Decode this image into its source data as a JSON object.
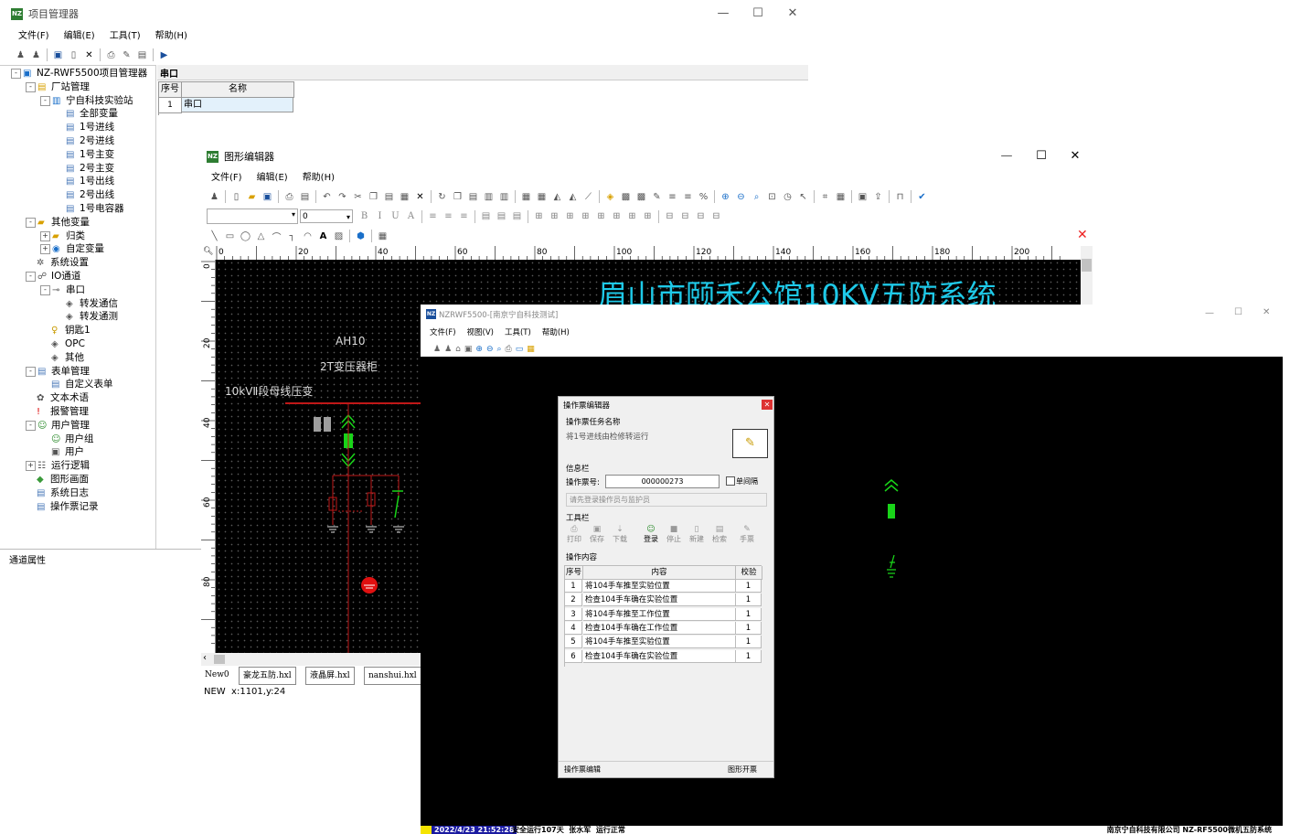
{
  "project_manager": {
    "title": "项目管理器",
    "menu": [
      "文件(F)",
      "编辑(E)",
      "工具(T)",
      "帮助(H)"
    ],
    "tree": [
      {
        "label": "NZ-RWF5500项目管理器",
        "icon": "root-icon",
        "depth": 0,
        "toggle": "-"
      },
      {
        "label": "厂站管理",
        "icon": "station-folder-icon",
        "depth": 1,
        "toggle": "-"
      },
      {
        "label": "宁自科技实验站",
        "icon": "station-icon",
        "depth": 2,
        "toggle": "-"
      },
      {
        "label": "全部变量",
        "icon": "variable-icon",
        "depth": 3,
        "toggle": ""
      },
      {
        "label": "1号进线",
        "icon": "variable-icon",
        "depth": 3,
        "toggle": ""
      },
      {
        "label": "2号进线",
        "icon": "variable-icon",
        "depth": 3,
        "toggle": ""
      },
      {
        "label": "1号主变",
        "icon": "variable-icon",
        "depth": 3,
        "toggle": ""
      },
      {
        "label": "2号主变",
        "icon": "variable-icon",
        "depth": 3,
        "toggle": ""
      },
      {
        "label": "1号出线",
        "icon": "variable-icon",
        "depth": 3,
        "toggle": ""
      },
      {
        "label": "2号出线",
        "icon": "variable-icon",
        "depth": 3,
        "toggle": ""
      },
      {
        "label": "1号电容器",
        "icon": "variable-icon",
        "depth": 3,
        "toggle": ""
      },
      {
        "label": "其他变量",
        "icon": "folder-icon",
        "depth": 1,
        "toggle": "-"
      },
      {
        "label": "归类",
        "icon": "folder-icon",
        "depth": 2,
        "toggle": "+"
      },
      {
        "label": "自定变量",
        "icon": "database-icon",
        "depth": 2,
        "toggle": "+"
      },
      {
        "label": "系统设置",
        "icon": "settings-icon",
        "depth": 1,
        "toggle": ""
      },
      {
        "label": "IO通道",
        "icon": "network-icon",
        "depth": 1,
        "toggle": "-"
      },
      {
        "label": "串口",
        "icon": "serial-port-icon",
        "depth": 2,
        "toggle": "-"
      },
      {
        "label": "转发通信",
        "icon": "channel-icon",
        "depth": 3,
        "toggle": ""
      },
      {
        "label": "转发通测",
        "icon": "channel-icon",
        "depth": 3,
        "toggle": ""
      },
      {
        "label": "钥匙1",
        "icon": "key-icon",
        "depth": 2,
        "toggle": ""
      },
      {
        "label": "OPC",
        "icon": "opc-icon",
        "depth": 2,
        "toggle": ""
      },
      {
        "label": "其他",
        "icon": "opc-icon",
        "depth": 2,
        "toggle": ""
      },
      {
        "label": "表单管理",
        "icon": "form-icon",
        "depth": 1,
        "toggle": "-"
      },
      {
        "label": "自定义表单",
        "icon": "form-icon",
        "depth": 2,
        "toggle": ""
      },
      {
        "label": "文本术语",
        "icon": "text-icon",
        "depth": 1,
        "toggle": ""
      },
      {
        "label": "报警管理",
        "icon": "alarm-icon",
        "depth": 1,
        "toggle": ""
      },
      {
        "label": "用户管理",
        "icon": "users-icon",
        "depth": 1,
        "toggle": "-"
      },
      {
        "label": "用户组",
        "icon": "user-group-icon",
        "depth": 2,
        "toggle": ""
      },
      {
        "label": "用户",
        "icon": "user-icon",
        "depth": 2,
        "toggle": ""
      },
      {
        "label": "运行逻辑",
        "icon": "logic-icon",
        "depth": 1,
        "toggle": "+"
      },
      {
        "label": "图形画面",
        "icon": "graphic-icon",
        "depth": 1,
        "toggle": ""
      },
      {
        "label": "系统日志",
        "icon": "log-icon",
        "depth": 1,
        "toggle": ""
      },
      {
        "label": "操作票记录",
        "icon": "log-icon",
        "depth": 1,
        "toggle": ""
      }
    ],
    "status_label": "通道属性",
    "panel_title": "串口",
    "grid_headers": [
      "序号",
      "名称"
    ],
    "grid_rows": [
      [
        "1",
        "串口"
      ]
    ]
  },
  "graphic_editor": {
    "title": "图形编辑器",
    "menu": [
      "文件(F)",
      "编辑(E)",
      "帮助(H)"
    ],
    "font_value": "",
    "size_value": "0",
    "ruler_top": [
      "0",
      "20",
      "40",
      "60",
      "80",
      "100",
      "120",
      "140",
      "160",
      "180",
      "200"
    ],
    "ruler_left": [
      "0",
      "20",
      "40",
      "60",
      "80"
    ],
    "canvas": {
      "big_title": "眉山市颐禾公馆10KV五防系统",
      "label_ah10": "AH10",
      "label_2t": "2T变压器柜",
      "label_bus": "10kVⅡ段母线压变"
    },
    "tabs": [
      "New0",
      "豪龙五防.hxl",
      "液晶屏.hxl",
      "nanshui.hxl"
    ],
    "status": "NEW  x:1101,y:24"
  },
  "nzrwf": {
    "title": "NZRWF5500-[南京宁自科技测试]",
    "menu": [
      "文件(F)",
      "视图(V)",
      "工具(T)",
      "帮助(H)"
    ],
    "status_bar": {
      "datetime": "2022/4/23 21:52:28",
      "info": "安全运行107天  张水军  运行正常",
      "company": "南京宁自科技有限公司 NZ-RF5500微机五防系统"
    }
  },
  "dialog": {
    "title": "操作票编辑器",
    "task_label": "操作票任务名称",
    "task_value": "将1号进线由检修转运行",
    "info_label": "信息栏",
    "ticket_no_label": "操作票号:",
    "ticket_no_value": "000000273",
    "single_interval_label": "单间隔",
    "login_hint": "请先登录操作员与监护员",
    "toolbar_label": "工具栏",
    "tools": [
      "打印",
      "保存",
      "下载",
      "登录",
      "停止",
      "新建",
      "检索",
      "手票"
    ],
    "content_label": "操作内容",
    "columns": [
      "序号",
      "内容",
      "校验"
    ],
    "rows": [
      [
        "1",
        "将104手车推至实验位置",
        "1"
      ],
      [
        "2",
        "检查104手车确在实验位置",
        "1"
      ],
      [
        "3",
        "将104手车推至工作位置",
        "1"
      ],
      [
        "4",
        "检查104手车确在工作位置",
        "1"
      ],
      [
        "5",
        "将104手车推至实验位置",
        "1"
      ],
      [
        "6",
        "检查104手车确在实验位置",
        "1"
      ]
    ],
    "footer_left": "操作票编辑",
    "footer_right": "图形开票"
  },
  "colors": {
    "canvas_title": "#1ec9e8",
    "bus_red": "#c01818",
    "green_equipment": "#19d419",
    "status_yellow": "#f5e400"
  }
}
